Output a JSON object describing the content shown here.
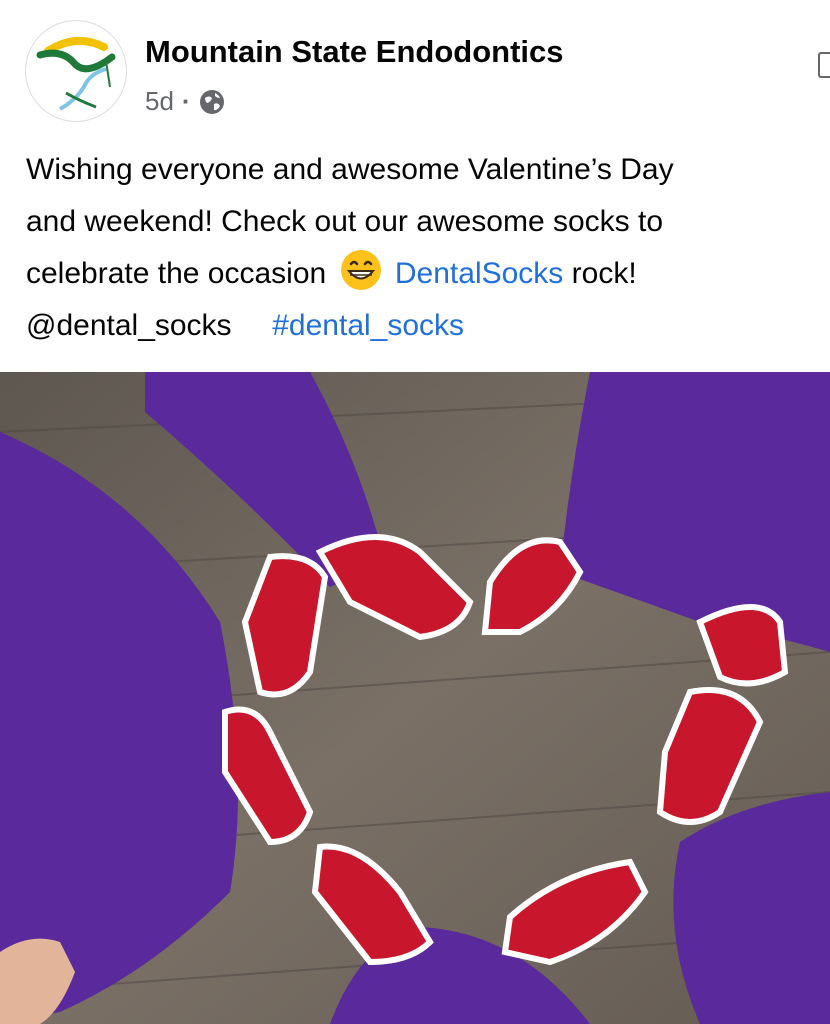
{
  "post": {
    "author": "Mountain State Endodontics",
    "time": "5d",
    "separator": "·",
    "privacy_icon": "globe-icon",
    "more_icon": "more-options-icon",
    "text": {
      "line1": "Wishing everyone and awesome Valentine’s Day",
      "line2": "and weekend!  Check out our awesome socks to",
      "line3_a": "celebrate the occasion",
      "emoji": "grinning-face-icon",
      "line3_link": "DentalSocks",
      "line3_b": " rock!",
      "mention": "@dental_socks",
      "hashtag": "#dental_socks"
    },
    "photo": {
      "subject": "red dental socks arranged in a heart on a wood floor",
      "colors": {
        "socks": "#c8172c",
        "scrubs": "#5a2a9c",
        "floor": "#6f665d"
      }
    }
  },
  "colors": {
    "link": "#216fdb",
    "secondary_text": "#65676b"
  }
}
